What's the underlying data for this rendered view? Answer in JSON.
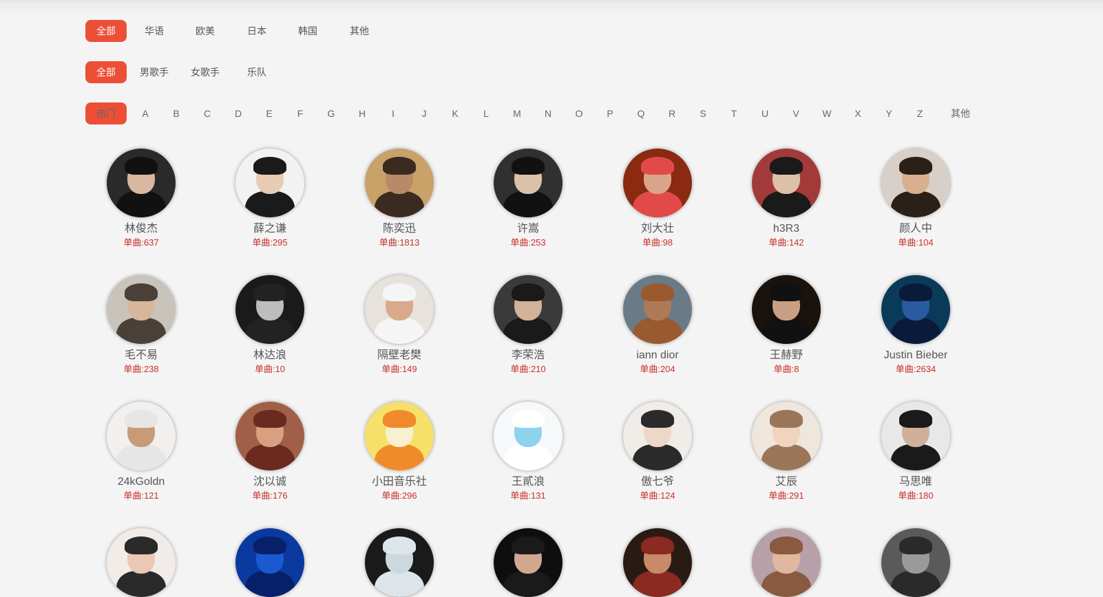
{
  "colors": {
    "accent": "#ec4f36",
    "count": "#c8302a",
    "background": "#f4f4f4"
  },
  "filters": {
    "area": [
      "全部",
      "华语",
      "欧美",
      "日本",
      "韩国",
      "其他"
    ],
    "type": [
      "全部",
      "男歌手",
      "女歌手",
      "乐队"
    ],
    "initial": [
      "热门",
      "A",
      "B",
      "C",
      "D",
      "E",
      "F",
      "G",
      "H",
      "I",
      "J",
      "K",
      "L",
      "M",
      "N",
      "O",
      "P",
      "Q",
      "R",
      "S",
      "T",
      "U",
      "V",
      "W",
      "X",
      "Y",
      "Z",
      "其他"
    ],
    "selected": {
      "area": "全部",
      "type": "全部",
      "initial": "热门"
    }
  },
  "artists": [
    {
      "name": "林俊杰",
      "count": "单曲:637",
      "palette": [
        "#2a2a2a",
        "#d8b8a0",
        "#111"
      ]
    },
    {
      "name": "薛之谦",
      "count": "单曲:295",
      "palette": [
        "#f2f2f2",
        "#e8cbb4",
        "#1a1a1a"
      ]
    },
    {
      "name": "陈奕迅",
      "count": "单曲:1813",
      "palette": [
        "#c9a26a",
        "#b98a68",
        "#3b2a20"
      ]
    },
    {
      "name": "许嵩",
      "count": "单曲:253",
      "palette": [
        "#303030",
        "#dcc1aa",
        "#111"
      ]
    },
    {
      "name": "刘大壮",
      "count": "单曲:98",
      "palette": [
        "#8a2a10",
        "#d9a58a",
        "#e24a4a"
      ]
    },
    {
      "name": "h3R3",
      "count": "单曲:142",
      "palette": [
        "#a33a3a",
        "#ddc0aa",
        "#1a1a1a"
      ]
    },
    {
      "name": "颜人中",
      "count": "单曲:104",
      "palette": [
        "#d8d0c8",
        "#d8b090",
        "#2a2018"
      ]
    },
    {
      "name": "毛不易",
      "count": "单曲:238",
      "palette": [
        "#c8c4bc",
        "#d6b79c",
        "#4a4038"
      ]
    },
    {
      "name": "林达浪",
      "count": "单曲:10",
      "palette": [
        "#1a1a1a",
        "#bdbdbd",
        "#222"
      ]
    },
    {
      "name": "隔壁老樊",
      "count": "单曲:149",
      "palette": [
        "#e8e2dc",
        "#d7aa8a",
        "#f5f5f5"
      ]
    },
    {
      "name": "李荣浩",
      "count": "单曲:210",
      "palette": [
        "#3a3a3a",
        "#d4b298",
        "#1a1a1a"
      ]
    },
    {
      "name": "iann dior",
      "count": "单曲:204",
      "palette": [
        "#6a7a86",
        "#b07a58",
        "#9a5a30"
      ]
    },
    {
      "name": "王赫野",
      "count": "单曲:8",
      "palette": [
        "#1a120c",
        "#caa084",
        "#111"
      ]
    },
    {
      "name": "Justin Bieber",
      "count": "单曲:2634",
      "palette": [
        "#0a3a5a",
        "#2a5aa0",
        "#0a1a3a"
      ]
    },
    {
      "name": "24kGoldn",
      "count": "单曲:121",
      "palette": [
        "#f2f0ee",
        "#c89a78",
        "#e6e6e6"
      ]
    },
    {
      "name": "沈以诚",
      "count": "单曲:176",
      "palette": [
        "#a06048",
        "#d8a080",
        "#6a2a20"
      ]
    },
    {
      "name": "小田音乐社",
      "count": "单曲:296",
      "palette": [
        "#f6e06a",
        "#f8f0d0",
        "#f08a2a"
      ]
    },
    {
      "name": "王貳浪",
      "count": "单曲:131",
      "palette": [
        "#f6f8fa",
        "#8fd2ee",
        "#ffffff"
      ]
    },
    {
      "name": "傲七爷",
      "count": "单曲:124",
      "palette": [
        "#f0ece8",
        "#eed6c8",
        "#2a2a2a"
      ]
    },
    {
      "name": "艾辰",
      "count": "单曲:291",
      "palette": [
        "#efe6dc",
        "#f0d4c0",
        "#9a7658"
      ]
    },
    {
      "name": "马思唯",
      "count": "单曲:180",
      "palette": [
        "#e8e8e8",
        "#d0b09a",
        "#1a1a1a"
      ]
    },
    {
      "name": "",
      "count": "",
      "palette": [
        "#f2ece8",
        "#eac8b4",
        "#2a2a2a"
      ]
    },
    {
      "name": "",
      "count": "",
      "palette": [
        "#0a3aa0",
        "#1a5ad0",
        "#08206a"
      ]
    },
    {
      "name": "",
      "count": "",
      "palette": [
        "#1a1a1a",
        "#ccd8e0",
        "#dde4ea"
      ]
    },
    {
      "name": "",
      "count": "",
      "palette": [
        "#0e0e0e",
        "#d0a890",
        "#1a1a1a"
      ]
    },
    {
      "name": "",
      "count": "",
      "palette": [
        "#2a1a14",
        "#c88a68",
        "#8a2a20"
      ]
    },
    {
      "name": "",
      "count": "",
      "palette": [
        "#b8a0a8",
        "#e0b8a0",
        "#8a5a40"
      ]
    },
    {
      "name": "",
      "count": "",
      "palette": [
        "#5a5a5a",
        "#9a9a9a",
        "#2a2a2a"
      ]
    }
  ]
}
